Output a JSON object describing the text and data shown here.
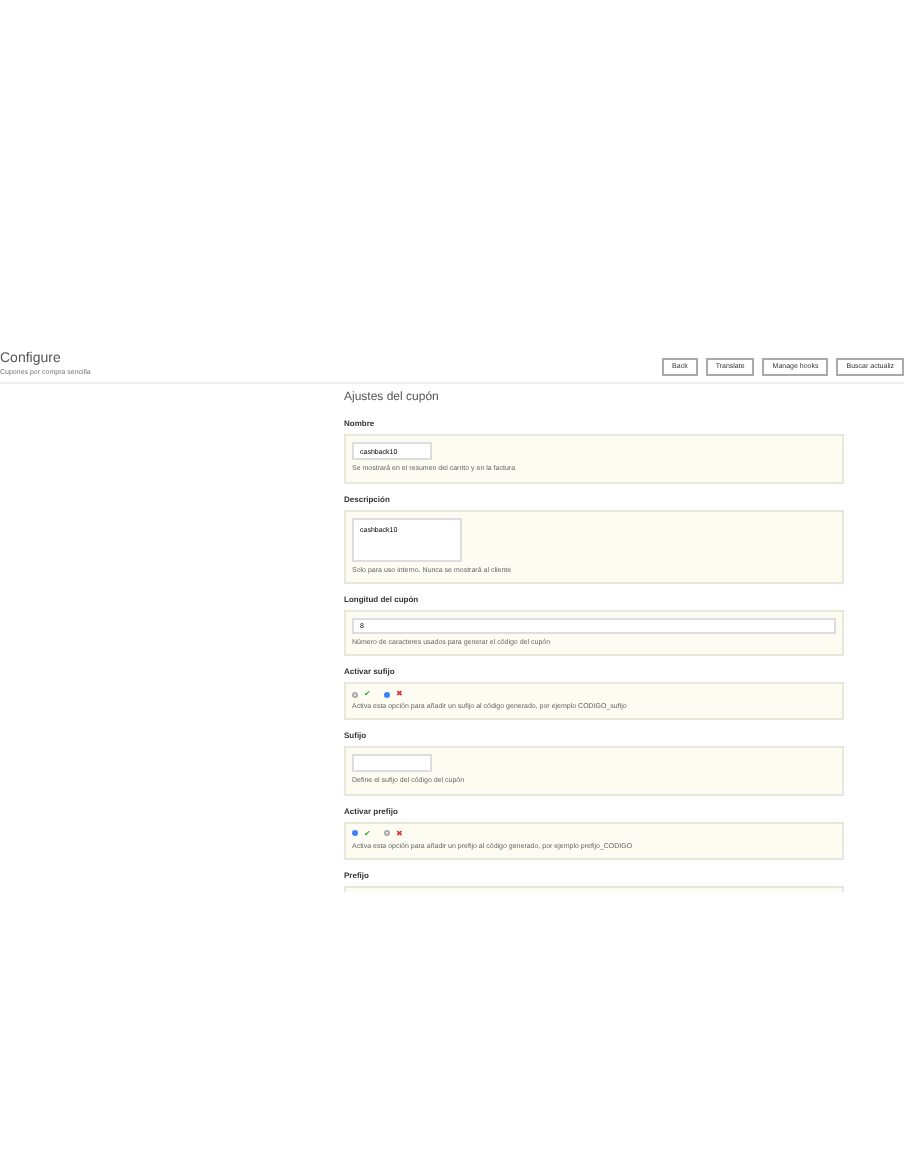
{
  "header": {
    "title": "Configure",
    "subtitle": "Cupones por compra sencilla"
  },
  "toolbar": [
    "Back",
    "Translate",
    "Manage hooks",
    "Buscar actualiz"
  ],
  "form": {
    "title": "Ajustes del cupón",
    "fields": [
      {
        "kind": "text",
        "label": "Nombre",
        "value": "cashback10",
        "help": "Se mostrará en el resumen del carrito y en la factura"
      },
      {
        "kind": "textarea",
        "label": "Descripción",
        "value": "cashback10",
        "help": "Solo para uso interno. Nunca se mostrará al cliente"
      },
      {
        "kind": "wide",
        "label": "Longitud del cupón",
        "value": "8",
        "help": "Número de caracteres usados para generar el código del cupón"
      },
      {
        "kind": "switch",
        "label": "Activar sufijo",
        "on": false,
        "yes": "✔",
        "no": "✖",
        "help": "Activa esta opción para añadir un sufijo al código generado, por ejemplo CODIGO_sufijo"
      },
      {
        "kind": "text",
        "label": "Sufijo",
        "help": "Define el sufijo del código del cupón"
      },
      {
        "kind": "switch",
        "label": "Activar prefijo",
        "on": true,
        "yes": "✔",
        "no": "✖",
        "help": "Activa esta opción para añadir un prefijo al código generado, por ejemplo prefijo_CODIGO"
      },
      {
        "kind": "cut",
        "label": "Prefijo"
      }
    ]
  }
}
